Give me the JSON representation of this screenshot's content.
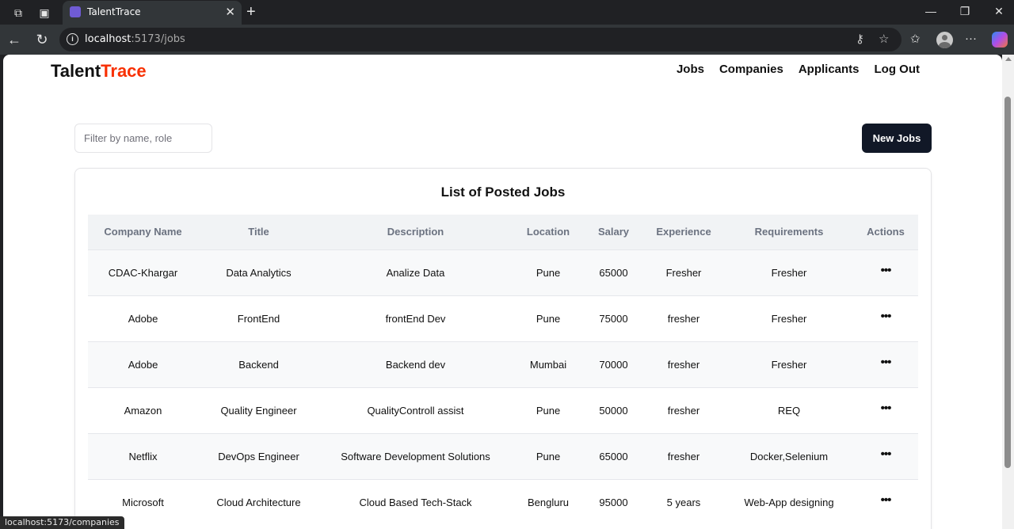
{
  "browser": {
    "tab_title": "TalentTrace",
    "url_host": "localhost",
    "url_path": ":5173/jobs",
    "status_url": "localhost:5173/companies"
  },
  "app": {
    "logo_part1": "Talent",
    "logo_part2": "Trace",
    "accent_color": "#f83002",
    "nav": [
      "Jobs",
      "Companies",
      "Applicants",
      "Log Out"
    ]
  },
  "controls": {
    "filter_placeholder": "Filter by name, role",
    "new_jobs_label": "New Jobs"
  },
  "table": {
    "caption": "List of Posted Jobs",
    "headers": [
      "Company Name",
      "Title",
      "Description",
      "Location",
      "Salary",
      "Experience",
      "Requirements",
      "Actions"
    ],
    "rows": [
      [
        "CDAC-Khargar",
        "Data Analytics",
        "Analize Data",
        "Pune",
        "65000",
        "Fresher",
        "Fresher",
        "•••"
      ],
      [
        "Adobe",
        "FrontEnd",
        "frontEnd Dev",
        "Pune",
        "75000",
        "fresher",
        "Fresher",
        "•••"
      ],
      [
        "Adobe",
        "Backend",
        "Backend dev",
        "Mumbai",
        "70000",
        "fresher",
        "Fresher",
        "•••"
      ],
      [
        "Amazon",
        "Quality Engineer",
        "QualityControll assist",
        "Pune",
        "50000",
        "fresher",
        "REQ",
        "•••"
      ],
      [
        "Netflix",
        "DevOps Engineer",
        "Software Development Solutions",
        "Pune",
        "65000",
        "fresher",
        "Docker,Selenium",
        "•••"
      ],
      [
        "Microsoft",
        "Cloud Architecture",
        "Cloud Based Tech-Stack",
        "Bengluru",
        "95000",
        "5 years",
        "Web-App designing",
        "•••"
      ]
    ]
  }
}
